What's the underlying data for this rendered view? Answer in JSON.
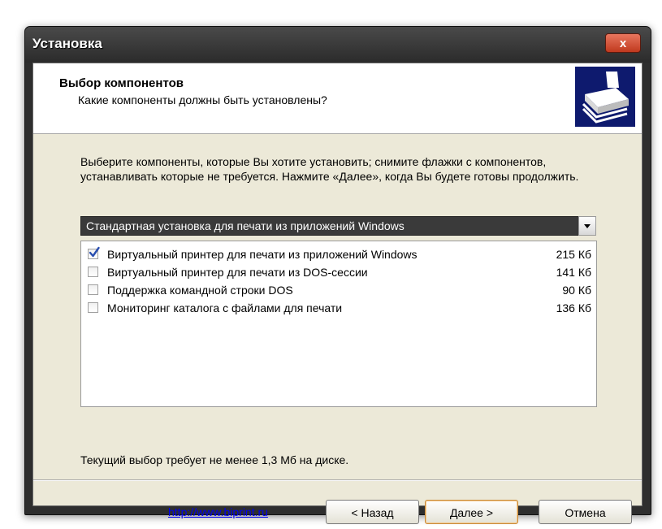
{
  "window": {
    "title": "Установка",
    "close_label": "x"
  },
  "header": {
    "title": "Выбор компонентов",
    "subtitle": "Какие компоненты должны быть установлены?",
    "icon": "printer-icon"
  },
  "description": "Выберите компоненты, которые Вы хотите установить; снимите флажки с компонентов, устанавливать которые не требуется. Нажмите «Далее», когда Вы будете готовы продолжить.",
  "install_type": {
    "selected": "Стандартная установка для печати из приложений Windows"
  },
  "components": [
    {
      "label": "Виртуальный принтер для печати из приложений Windows",
      "size": "215 Кб",
      "checked": true
    },
    {
      "label": "Виртуальный принтер для печати из DOS-сессии",
      "size": "141 Кб",
      "checked": false
    },
    {
      "label": "Поддержка командной строки DOS",
      "size": "90 Кб",
      "checked": false
    },
    {
      "label": "Мониторинг каталога с файлами для печати",
      "size": "136 Кб",
      "checked": false
    }
  ],
  "disk_space_text": "Текущий выбор требует не менее 1,3 Мб на диске.",
  "footer": {
    "link": "http://www.biprint.ru",
    "back_label": "< Назад",
    "next_label": "Далее >",
    "cancel_label": "Отмена"
  },
  "colors": {
    "accent": "#0e1a6e",
    "checkmark": "#2a4fb0",
    "link": "#0000ee"
  }
}
